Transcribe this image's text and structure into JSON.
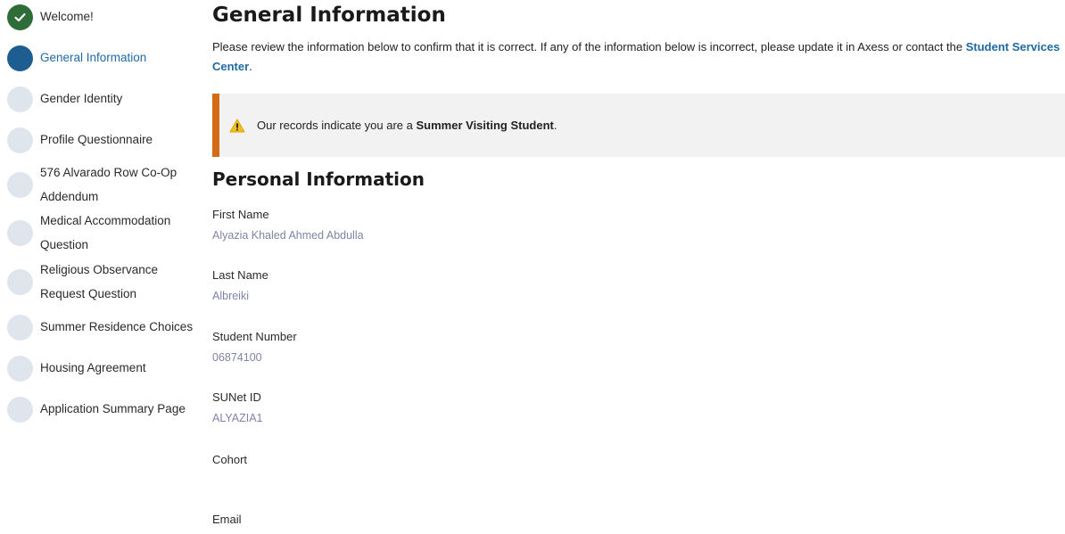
{
  "sidebar": {
    "items": [
      {
        "label": "Welcome!",
        "state": "done"
      },
      {
        "label": "General Information",
        "state": "current"
      },
      {
        "label": "Gender Identity",
        "state": "todo"
      },
      {
        "label": "Profile Questionnaire",
        "state": "todo"
      },
      {
        "label_lines": [
          "576 Alvarado Row Co-Op",
          "Addendum"
        ],
        "state": "todo"
      },
      {
        "label_lines": [
          "Medical Accommodation",
          "Question"
        ],
        "state": "todo"
      },
      {
        "label_lines": [
          "Religious Observance",
          "Request Question"
        ],
        "state": "todo"
      },
      {
        "label": "Summer Residence Choices",
        "state": "todo"
      },
      {
        "label": "Housing Agreement",
        "state": "todo"
      },
      {
        "label": "Application Summary Page",
        "state": "todo"
      }
    ]
  },
  "main": {
    "title": "General Information",
    "intro_text": "Please review the information below to confirm that it is correct. If any of the information below is incorrect, please update it in Axess or contact the",
    "intro_link": "Student Services Center",
    "intro_end": ".",
    "alert": {
      "prefix": "Our records indicate you are a",
      "status": "Summer Visiting Student",
      "suffix": "."
    },
    "section_title": "Personal Information",
    "fields": [
      {
        "label": "First Name",
        "value": "Alyazia Khaled Ahmed Abdulla"
      },
      {
        "label": "Last Name",
        "value": "Albreiki"
      },
      {
        "label": "Student Number",
        "value": "06874100"
      },
      {
        "label": "SUNet ID",
        "value": "ALYAZIA1"
      },
      {
        "label": "Cohort",
        "value": ""
      },
      {
        "label": "Email",
        "value": ""
      }
    ]
  },
  "colors": {
    "done": "#2e6d37",
    "current": "#1d5d8f",
    "todo": "#dfe5ec",
    "link": "#1f6aa5",
    "alert_border": "#d46a19",
    "alert_bg": "#f2f2f2",
    "value_text": "#7f84a8"
  },
  "icons": {
    "done": "check-icon",
    "alert": "warning-icon"
  }
}
